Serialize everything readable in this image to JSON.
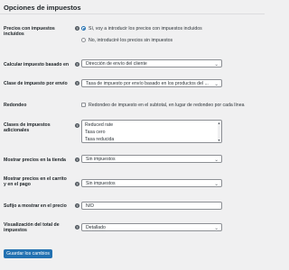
{
  "page": {
    "title": "Opciones de impuestos"
  },
  "prices_incl_tax": {
    "label": "Precios con impuestos incluidos",
    "options": [
      "Sí, voy a introducir los precios con impuestos incluidos",
      "No, introduciré los precios sin impuestos"
    ],
    "selected_index": 0
  },
  "calc_based_on": {
    "label": "Calcular impuesto basado en",
    "value": "Dirección de envío del cliente"
  },
  "shipping_tax_class": {
    "label": "Clase de impuesto por envío",
    "value": "Tasa de impuesto por envío basado en los productos del ..."
  },
  "rounding": {
    "label": "Redondeo",
    "checkbox_label": "Redondeo de impuesto en el subtotal, en lugar de redondeo por cada línea",
    "checked": false
  },
  "additional_classes": {
    "label": "Clases de impuestos adicionales",
    "lines": [
      "Reduced rate",
      "Tasa cero",
      "Tasa reducida"
    ]
  },
  "display_in_shop": {
    "label": "Mostrar precios en la tienda",
    "value": "Sin impuestos"
  },
  "display_in_cart": {
    "label": "Mostrar precios en el carrito y en el pago",
    "value": "Sin impuestos"
  },
  "price_suffix": {
    "label": "Sufijo a mostrar en el precio",
    "value": "N/D"
  },
  "totals_display": {
    "label": "Visualización del total de impuestos",
    "value": "Detallado"
  },
  "save_button": {
    "label": "Guardar los cambios"
  },
  "icons": {
    "help": "help-icon",
    "dropdown": "chevron-down-icon"
  },
  "colors": {
    "accent": "#2271b1",
    "background": "#f0f0f1",
    "help_icon": "#50575e"
  }
}
